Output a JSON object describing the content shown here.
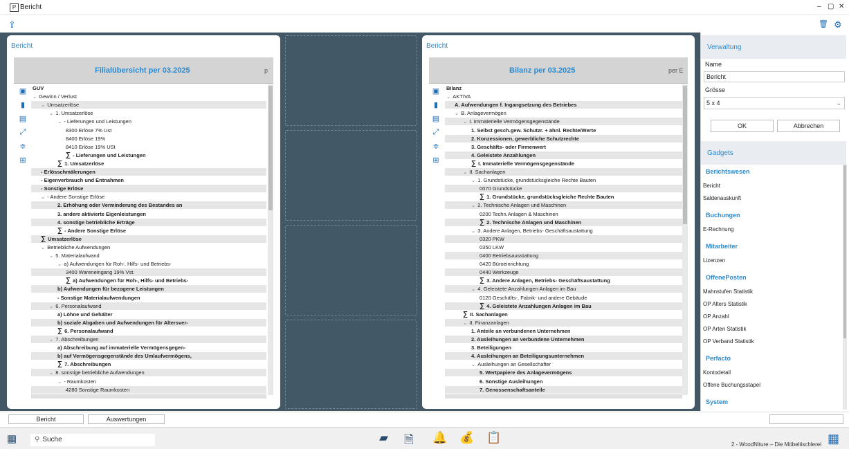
{
  "window": {
    "title": "Bericht",
    "app_icon_text": "P"
  },
  "colors": {
    "accent": "#2a8ad0",
    "workspace_bg": "#425867",
    "header_bg": "#d4d4d4"
  },
  "left_card": {
    "title": "Bericht",
    "report_title": "Filialübersicht per 03.2025",
    "col_label": "p",
    "rows": [
      {
        "t": "GUV",
        "b": true,
        "ind": 0
      },
      {
        "t": "Gewinn / Verlust",
        "ind": 0,
        "chev": true
      },
      {
        "t": "Umsatzerlöse",
        "ind": 1,
        "chev": true,
        "shade": true
      },
      {
        "t": "1. Umsatzerlöse",
        "ind": 2,
        "chev": true
      },
      {
        "t": "- Lieferungen und Leistungen",
        "ind": 3,
        "chev": true
      },
      {
        "t": "8300 Erlöse 7% Ust",
        "ind": 4
      },
      {
        "t": "8400 Erlöse 19%",
        "ind": 4
      },
      {
        "t": "8410 Erlöse 19% USt",
        "ind": 4
      },
      {
        "t": "- Lieferungen und Leistungen",
        "ind": 4,
        "b": true,
        "sigma": true
      },
      {
        "t": "1. Umsatzerlöse",
        "ind": 3,
        "b": true,
        "sigma": true
      },
      {
        "t": "- Erlösschmälerungen",
        "ind": 1,
        "b": true,
        "shade": true
      },
      {
        "t": "- Eigenverbrauch und Entnahmen",
        "ind": 1,
        "b": true
      },
      {
        "t": "- Sonstige Erlöse",
        "ind": 1,
        "b": true,
        "shade": true
      },
      {
        "t": "- Andere Sonstige Erlöse",
        "ind": 1,
        "chev": true
      },
      {
        "t": "2. Erhöhung oder Verminderung des Bestandes an",
        "ind": 3,
        "b": true,
        "shade": true
      },
      {
        "t": "3. andere aktivierte Eigenleistungen",
        "ind": 3,
        "b": true
      },
      {
        "t": "4. sonstige betriebliche Erträge",
        "ind": 3,
        "b": true,
        "shade": true
      },
      {
        "t": "- Andere Sonstige Erlöse",
        "ind": 3,
        "b": true,
        "sigma": true
      },
      {
        "t": "Umsatzerlöse",
        "ind": 1,
        "b": true,
        "sigma": true,
        "shade": true
      },
      {
        "t": "Betriebliche Aufwendungen",
        "ind": 1,
        "chev": true
      },
      {
        "t": "5. Materialaufwand",
        "ind": 2,
        "chev": true
      },
      {
        "t": "a) Aufwendungen für Roh-, Hilfs- und Betriebs-",
        "ind": 3,
        "chev": true
      },
      {
        "t": "3400 Wareneingang 19% Vst.",
        "ind": 4,
        "shade": true
      },
      {
        "t": "a) Aufwendungen für Roh-, Hilfs- und Betriebs-",
        "ind": 4,
        "b": true,
        "sigma": true
      },
      {
        "t": "b) Aufwendungen für bezogene Leistungen",
        "ind": 3,
        "b": true,
        "shade": true
      },
      {
        "t": "- Sonstige Materialaufwendungen",
        "ind": 3,
        "b": true
      },
      {
        "t": "6. Personalaufwand",
        "ind": 2,
        "chev": true,
        "shade": true
      },
      {
        "t": "a) Löhne und Gehälter",
        "ind": 3,
        "b": true
      },
      {
        "t": "b) soziale Abgaben und Aufwendungen für Altersver-",
        "ind": 3,
        "b": true,
        "shade": true
      },
      {
        "t": "6. Personalaufwand",
        "ind": 3,
        "b": true,
        "sigma": true
      },
      {
        "t": "7. Abschreibungen",
        "ind": 2,
        "chev": true,
        "shade": true
      },
      {
        "t": "a) Abschreibung auf immaterielle Vermögensgegen-",
        "ind": 3,
        "b": true
      },
      {
        "t": "b) auf Vermögensgegenstände des Umlaufvermögens,",
        "ind": 3,
        "b": true,
        "shade": true
      },
      {
        "t": "7. Abschreibungen",
        "ind": 3,
        "b": true,
        "sigma": true
      },
      {
        "t": "8. sonstige betriebliche Aufwendungen",
        "ind": 2,
        "chev": true,
        "shade": true
      },
      {
        "t": "- Raumkosten",
        "ind": 3,
        "chev": true
      },
      {
        "t": "4280 Sonstige Raumkosten",
        "ind": 4,
        "shade": true
      }
    ]
  },
  "right_card": {
    "title": "Bericht",
    "report_title": "Bilanz per 03.2025",
    "col_label": "per E",
    "rows": [
      {
        "t": "Bilanz",
        "b": true,
        "ind": 0
      },
      {
        "t": "AKTIVA",
        "ind": 0,
        "chev": true
      },
      {
        "t": "A. Aufwendungen f. Ingangsetzung des Betriebes",
        "ind": 1,
        "b": true,
        "shade": true
      },
      {
        "t": "B. Anlagevermögen",
        "ind": 1,
        "chev": true
      },
      {
        "t": "I. Immaterielle Vermögensgegenstände",
        "ind": 2,
        "chev": true,
        "shade": true
      },
      {
        "t": "1. Selbst gesch.gew. Schutzr. + ähnl. Rechte/Werte",
        "ind": 3,
        "b": true
      },
      {
        "t": "2. Konzessionen, gewerbliche Schutzrechte",
        "ind": 3,
        "b": true,
        "shade": true
      },
      {
        "t": "3. Geschäfts- oder Firmenwert",
        "ind": 3,
        "b": true
      },
      {
        "t": "4. Geleistete Anzahlungen",
        "ind": 3,
        "b": true,
        "shade": true
      },
      {
        "t": "I. Immaterielle Vermögensgegenstände",
        "ind": 3,
        "b": true,
        "sigma": true
      },
      {
        "t": "II. Sachanlagen",
        "ind": 2,
        "chev": true,
        "shade": true
      },
      {
        "t": "1. Grundstücke, grundstücksgleiche Rechte  Bauten",
        "ind": 3,
        "chev": true
      },
      {
        "t": "0070 Grundstücke",
        "ind": 4,
        "shade": true
      },
      {
        "t": "1. Grundstücke, grundstücksgleiche Rechte  Bauten",
        "ind": 4,
        "b": true,
        "sigma": true
      },
      {
        "t": "2. Technische Anlagen und Maschinen",
        "ind": 3,
        "chev": true,
        "shade": true
      },
      {
        "t": "0200 Techn.Anlagen &  Maschinen",
        "ind": 4
      },
      {
        "t": "2. Technische Anlagen und Maschinen",
        "ind": 4,
        "b": true,
        "sigma": true,
        "shade": true
      },
      {
        "t": "3. Andere Anlagen, Betriebs-  Geschäftsaustattung",
        "ind": 3,
        "chev": true
      },
      {
        "t": "0320 PKW",
        "ind": 4,
        "shade": true
      },
      {
        "t": "0350 LKW",
        "ind": 4
      },
      {
        "t": "0400 Betriebsausstattung",
        "ind": 4,
        "shade": true
      },
      {
        "t": "0420 Büroeinrichtung",
        "ind": 4
      },
      {
        "t": "0440 Werkzeuge",
        "ind": 4,
        "shade": true
      },
      {
        "t": "3. Andere Anlagen, Betriebs-  Geschäftsaustattung",
        "ind": 4,
        "b": true,
        "sigma": true
      },
      {
        "t": "4. Geleistete Anzahlungen  Anlagen im Bau",
        "ind": 3,
        "chev": true,
        "shade": true
      },
      {
        "t": "0120 Geschäfts-, Fabrik- und andere Gebäude",
        "ind": 4
      },
      {
        "t": "4. Geleistete Anzahlungen  Anlagen im Bau",
        "ind": 4,
        "b": true,
        "sigma": true,
        "shade": true
      },
      {
        "t": "II. Sachanlagen",
        "ind": 2,
        "b": true,
        "sigma": true
      },
      {
        "t": "II. Finanzanlagen",
        "ind": 2,
        "chev": true,
        "shade": true
      },
      {
        "t": "1. Anteile an verbundenen Unternehmen",
        "ind": 3,
        "b": true
      },
      {
        "t": "2. Ausleihungen an verbundene Unternehmen",
        "ind": 3,
        "b": true,
        "shade": true
      },
      {
        "t": "3. Beteiligungen",
        "ind": 3,
        "b": true
      },
      {
        "t": "4. Ausleihungen an Beteiligungsunternehmen",
        "ind": 3,
        "b": true,
        "shade": true
      },
      {
        "t": "Ausleihungen an Gesellschafter",
        "ind": 3,
        "chev": true
      },
      {
        "t": "5. Wertpapiere des Anlagevermögens",
        "ind": 4,
        "b": true,
        "shade": true
      },
      {
        "t": "6. Sonstige Ausleihungen",
        "ind": 4,
        "b": true
      },
      {
        "t": "7. Genossenschaftsanteile",
        "ind": 4,
        "b": true,
        "shade": true
      }
    ]
  },
  "right_panel": {
    "header": "Verwaltung",
    "name_label": "Name",
    "name_value": "Bericht",
    "size_label": "Grösse",
    "size_value": "5 x 4",
    "ok_label": "OK",
    "cancel_label": "Abbrechen",
    "gadgets_header": "Gadgets",
    "gadgets": [
      {
        "group": "Berichtswesen",
        "items": [
          "Bericht",
          "Saldenauskunft"
        ]
      },
      {
        "group": "Buchungen",
        "items": [
          "E-Rechnung"
        ]
      },
      {
        "group": "Mitarbeiter",
        "items": [
          "Lizenzen"
        ]
      },
      {
        "group": "OffenePosten",
        "items": [
          "Mahnstufen Statistik",
          "OP Alters Statistik",
          "OP Anzahl",
          "OP Arten Statistik",
          "OP Verband Statistik"
        ]
      },
      {
        "group": "Perfacto",
        "items": [
          "Kontodetail",
          "Offene Buchungsstapel"
        ]
      },
      {
        "group": "System",
        "items": []
      }
    ]
  },
  "bottom_tabs": [
    "Bericht",
    "Auswertungen"
  ],
  "taskbar": {
    "search_placeholder": "Suche",
    "status": "2 - WoodNiture – Die Möbeltischlerei",
    "icons": [
      "book-icon",
      "document-edit-icon",
      "bell-settings-icon",
      "money-bag-icon",
      "report-icon"
    ]
  }
}
